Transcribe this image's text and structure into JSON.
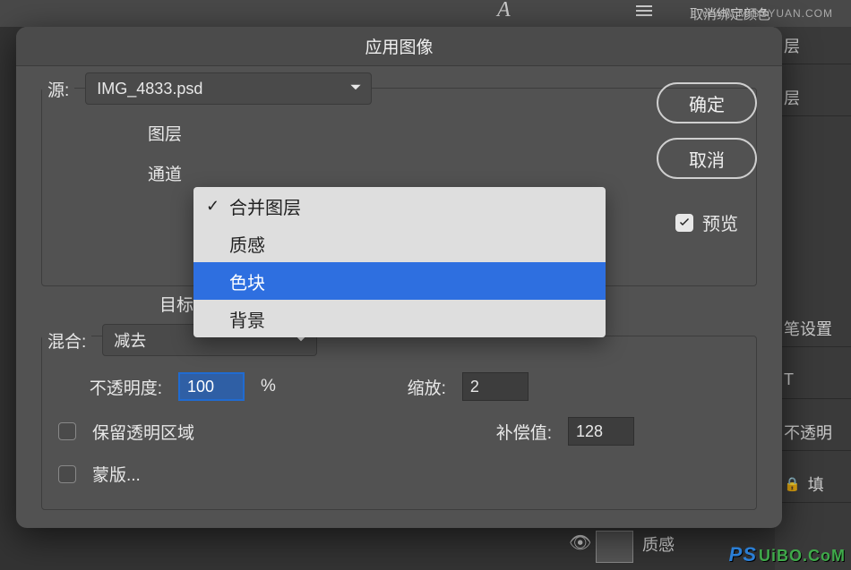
{
  "bg": {
    "top_text": "取消绑定颜色",
    "wm": "WWW.MISSYUAN.COM",
    "right_rows": {
      "r1": "层",
      "r2": "层",
      "r3": "笔设置",
      "r4": "不透明",
      "r5": "填",
      "T": "T"
    },
    "thumb_label": "质感"
  },
  "dialog": {
    "title": "应用图像",
    "source_label": "源:",
    "source_value": "IMG_4833.psd",
    "layer_label": "图层",
    "channel_label": "通道",
    "target_label": "目标",
    "blend_label": "混合:",
    "blend_value": "减去",
    "opacity_label": "不透明度:",
    "opacity_value": "100",
    "opacity_unit": "%",
    "scale_label": "缩放:",
    "scale_value": "2",
    "offset_label": "补偿值:",
    "offset_value": "128",
    "preserve_label": "保留透明区域",
    "mask_label": "蒙版...",
    "ok": "确定",
    "cancel": "取消",
    "preview": "预览"
  },
  "dropdown": {
    "opt1": "合并图层",
    "opt2": "质感",
    "opt3": "色块",
    "opt4": "背景"
  },
  "watermark": {
    "ps": "PS",
    "u": "UiBO.CoM"
  }
}
